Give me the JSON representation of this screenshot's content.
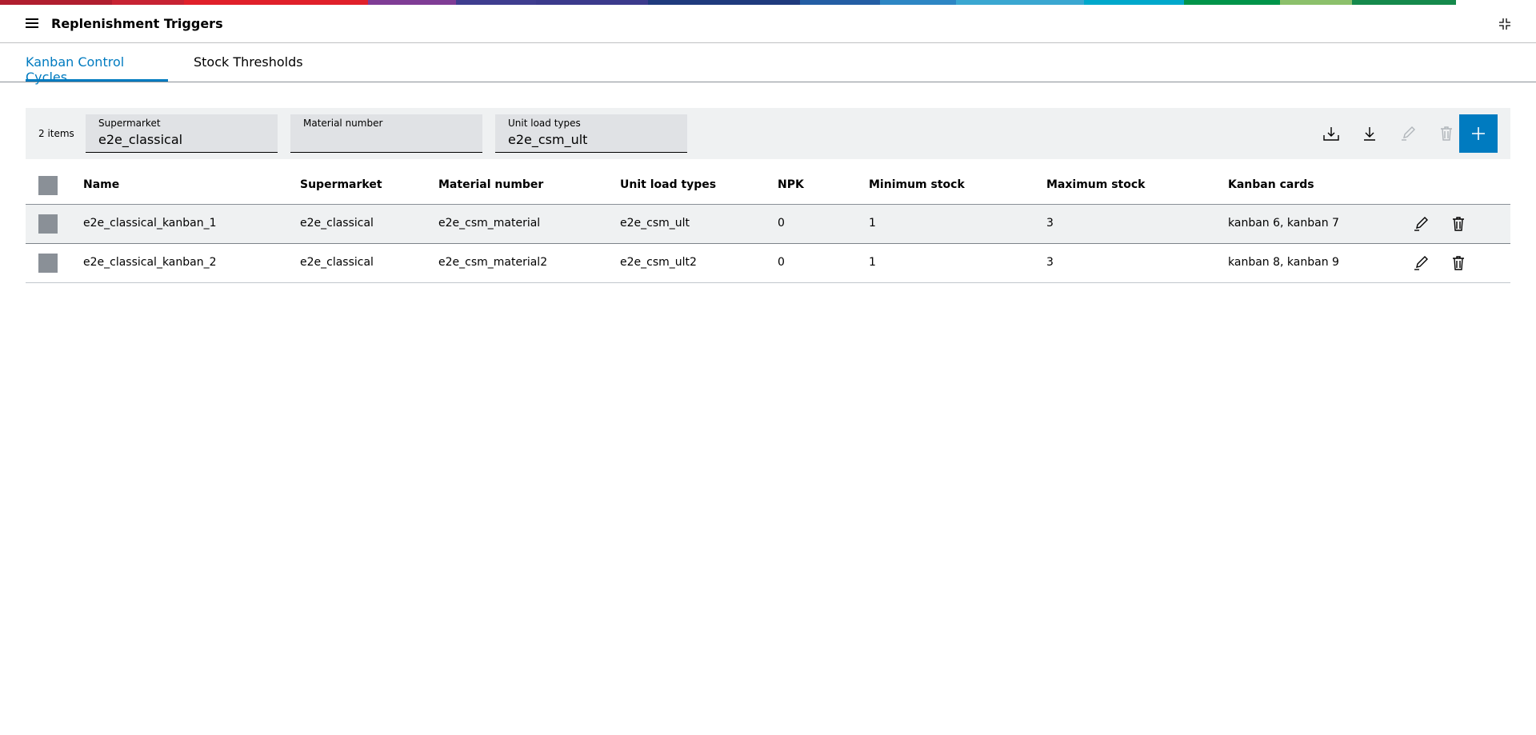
{
  "header": {
    "title": "Replenishment Triggers"
  },
  "tabs": [
    {
      "label": "Kanban Control Cycles",
      "active": true
    },
    {
      "label": "Stock Thresholds",
      "active": false
    }
  ],
  "toolbar": {
    "item_count": "2 items",
    "filters": [
      {
        "label": "Supermarket",
        "value": "e2e_classical"
      },
      {
        "label": "Material number",
        "value": ""
      },
      {
        "label": "Unit load types",
        "value": "e2e_csm_ult"
      }
    ],
    "icons": [
      "upload-icon",
      "download-icon",
      "edit-icon",
      "delete-icon",
      "add-icon"
    ]
  },
  "table": {
    "columns": [
      "Name",
      "Supermarket",
      "Material number",
      "Unit load types",
      "NPK",
      "Minimum stock",
      "Maximum stock",
      "Kanban cards"
    ],
    "rows": [
      [
        "e2e_classical_kanban_1",
        "e2e_classical",
        "e2e_csm_material",
        "e2e_csm_ult",
        "0",
        "1",
        "3",
        "kanban 6, kanban 7"
      ],
      [
        "e2e_classical_kanban_2",
        "e2e_classical",
        "e2e_csm_material2",
        "e2e_csm_ult2",
        "0",
        "1",
        "3",
        "kanban 8, kanban 9"
      ]
    ]
  },
  "colors": {
    "accent": "#007bc0",
    "toolbar_bg": "#eff1f2",
    "field_bg": "#e0e2e5",
    "checkbox": "#8a9097",
    "disabled_icon": "#b0b5ba",
    "rainbow": [
      "#b01e2f",
      "#c72333",
      "#e0202a",
      "#7f3c95",
      "#3f3d8f",
      "#1f3a7d",
      "#245ea4",
      "#2d86c4",
      "#3aa7d1",
      "#00a8cb",
      "#00944a",
      "#8cc06b",
      "#15894c"
    ]
  }
}
